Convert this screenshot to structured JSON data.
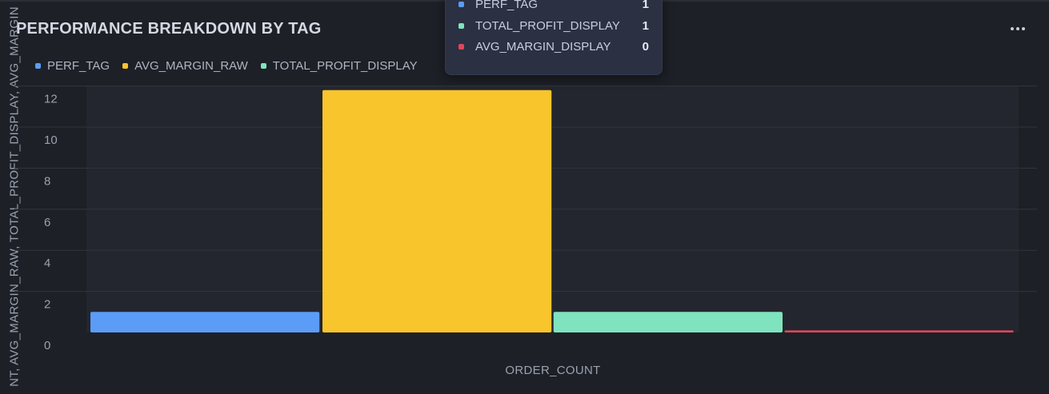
{
  "header": {
    "title": "PERFORMANCE BREAKDOWN BY TAG",
    "more_icon": "ellipsis-horizontal-icon"
  },
  "legend": [
    {
      "label": "PERF_TAG",
      "color": "#5b9cf6"
    },
    {
      "label": "AVG_MARGIN_RAW",
      "color": "#f9c52c"
    },
    {
      "label": "TOTAL_PROFIT_DISPLAY",
      "color": "#7fe3bf"
    }
  ],
  "tooltip": {
    "rows": [
      {
        "label": "PERF_TAG",
        "value": "1",
        "color": "#5b9cf6"
      },
      {
        "label": "TOTAL_PROFIT_DISPLAY",
        "value": "1",
        "color": "#7fe3bf"
      },
      {
        "label": "AVG_MARGIN_DISPLAY",
        "value": "0",
        "color": "#e0475a"
      }
    ]
  },
  "chart_data": {
    "type": "bar",
    "title": "PERFORMANCE BREAKDOWN BY TAG",
    "xlabel": "ORDER_COUNT",
    "ylabel": "NT, AVG_MARGIN_RAW, TOTAL_PROFIT_DISPLAY, AVG_MARGIN",
    "ylim": [
      0,
      12
    ],
    "yticks": [
      "0",
      "2",
      "4",
      "6",
      "8",
      "10",
      "12"
    ],
    "grid": true,
    "legend_position": "top-left",
    "series": [
      {
        "name": "PERF_TAG",
        "values": [
          1
        ],
        "color": "#5b9cf6"
      },
      {
        "name": "AVG_MARGIN_RAW",
        "values": [
          11.8
        ],
        "color": "#f9c52c"
      },
      {
        "name": "TOTAL_PROFIT_DISPLAY",
        "values": [
          1
        ],
        "color": "#7fe3bf"
      },
      {
        "name": "AVG_MARGIN_DISPLAY",
        "values": [
          0.1
        ],
        "color": "#e0475a"
      }
    ]
  }
}
